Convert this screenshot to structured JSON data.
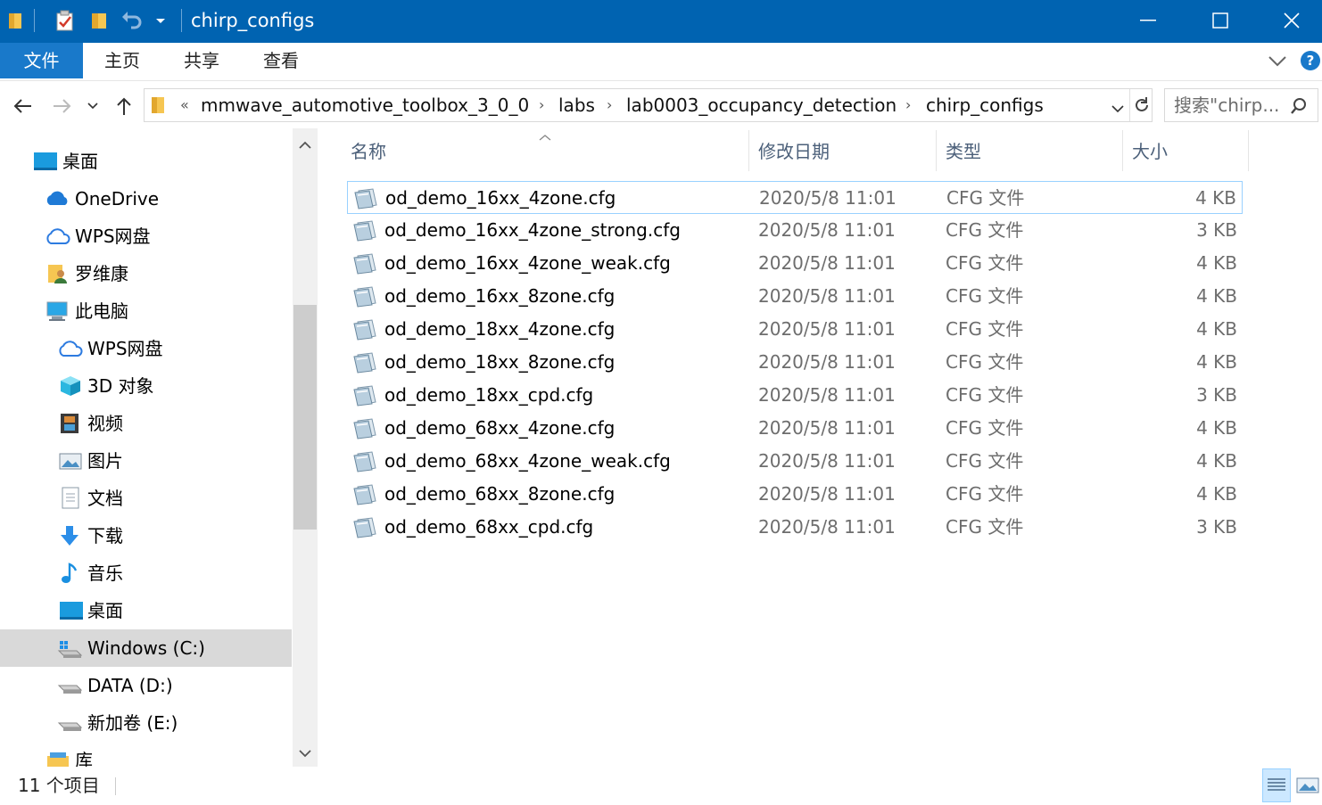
{
  "window": {
    "title": "chirp_configs",
    "minimize_glyph": "—",
    "maximize_glyph": "☐",
    "close_glyph": "✕"
  },
  "ribbon": {
    "tabs": [
      "文件",
      "主页",
      "共享",
      "查看"
    ],
    "help_label": "?"
  },
  "address": {
    "overflow_glyph": "«",
    "breadcrumbs": [
      "mmwave_automotive_toolbox_3_0_0",
      "labs",
      "lab0003_occupancy_detection",
      "chirp_configs"
    ]
  },
  "search": {
    "placeholder": "搜索\"chirp..."
  },
  "sidebar": {
    "items": [
      {
        "label": "桌面",
        "icon": "desktop-icon"
      },
      {
        "label": "OneDrive",
        "icon": "onedrive-icon"
      },
      {
        "label": "WPS网盘",
        "icon": "cloud-icon"
      },
      {
        "label": "罗维康",
        "icon": "user-folder-icon"
      },
      {
        "label": "此电脑",
        "icon": "computer-icon"
      },
      {
        "label": "WPS网盘",
        "icon": "cloud-icon"
      },
      {
        "label": "3D 对象",
        "icon": "cube-icon"
      },
      {
        "label": "视频",
        "icon": "film-icon"
      },
      {
        "label": "图片",
        "icon": "picture-icon"
      },
      {
        "label": "文档",
        "icon": "document-icon"
      },
      {
        "label": "下载",
        "icon": "download-icon"
      },
      {
        "label": "音乐",
        "icon": "music-icon"
      },
      {
        "label": "桌面",
        "icon": "desktop-icon"
      },
      {
        "label": "Windows (C:)",
        "icon": "windows-drive-icon"
      },
      {
        "label": "DATA (D:)",
        "icon": "drive-icon"
      },
      {
        "label": "新加卷 (E:)",
        "icon": "drive-icon"
      },
      {
        "label": "库",
        "icon": "library-icon"
      }
    ]
  },
  "file_list": {
    "columns": {
      "name": "名称",
      "date": "修改日期",
      "type": "类型",
      "size": "大小"
    },
    "rows": [
      {
        "name": "od_demo_16xx_4zone.cfg",
        "date": "2020/5/8 11:01",
        "type": "CFG 文件",
        "size": "4 KB"
      },
      {
        "name": "od_demo_16xx_4zone_strong.cfg",
        "date": "2020/5/8 11:01",
        "type": "CFG 文件",
        "size": "3 KB"
      },
      {
        "name": "od_demo_16xx_4zone_weak.cfg",
        "date": "2020/5/8 11:01",
        "type": "CFG 文件",
        "size": "4 KB"
      },
      {
        "name": "od_demo_16xx_8zone.cfg",
        "date": "2020/5/8 11:01",
        "type": "CFG 文件",
        "size": "4 KB"
      },
      {
        "name": "od_demo_18xx_4zone.cfg",
        "date": "2020/5/8 11:01",
        "type": "CFG 文件",
        "size": "4 KB"
      },
      {
        "name": "od_demo_18xx_8zone.cfg",
        "date": "2020/5/8 11:01",
        "type": "CFG 文件",
        "size": "4 KB"
      },
      {
        "name": "od_demo_18xx_cpd.cfg",
        "date": "2020/5/8 11:01",
        "type": "CFG 文件",
        "size": "3 KB"
      },
      {
        "name": "od_demo_68xx_4zone.cfg",
        "date": "2020/5/8 11:01",
        "type": "CFG 文件",
        "size": "4 KB"
      },
      {
        "name": "od_demo_68xx_4zone_weak.cfg",
        "date": "2020/5/8 11:01",
        "type": "CFG 文件",
        "size": "4 KB"
      },
      {
        "name": "od_demo_68xx_8zone.cfg",
        "date": "2020/5/8 11:01",
        "type": "CFG 文件",
        "size": "4 KB"
      },
      {
        "name": "od_demo_68xx_cpd.cfg",
        "date": "2020/5/8 11:01",
        "type": "CFG 文件",
        "size": "3 KB"
      }
    ]
  },
  "status": {
    "item_count": "11 个项目"
  },
  "colors": {
    "title_bar": "#0063b1",
    "file_tab": "#1979ca",
    "selected_nav": "#d9d9d9",
    "header_text": "#4c607a"
  }
}
